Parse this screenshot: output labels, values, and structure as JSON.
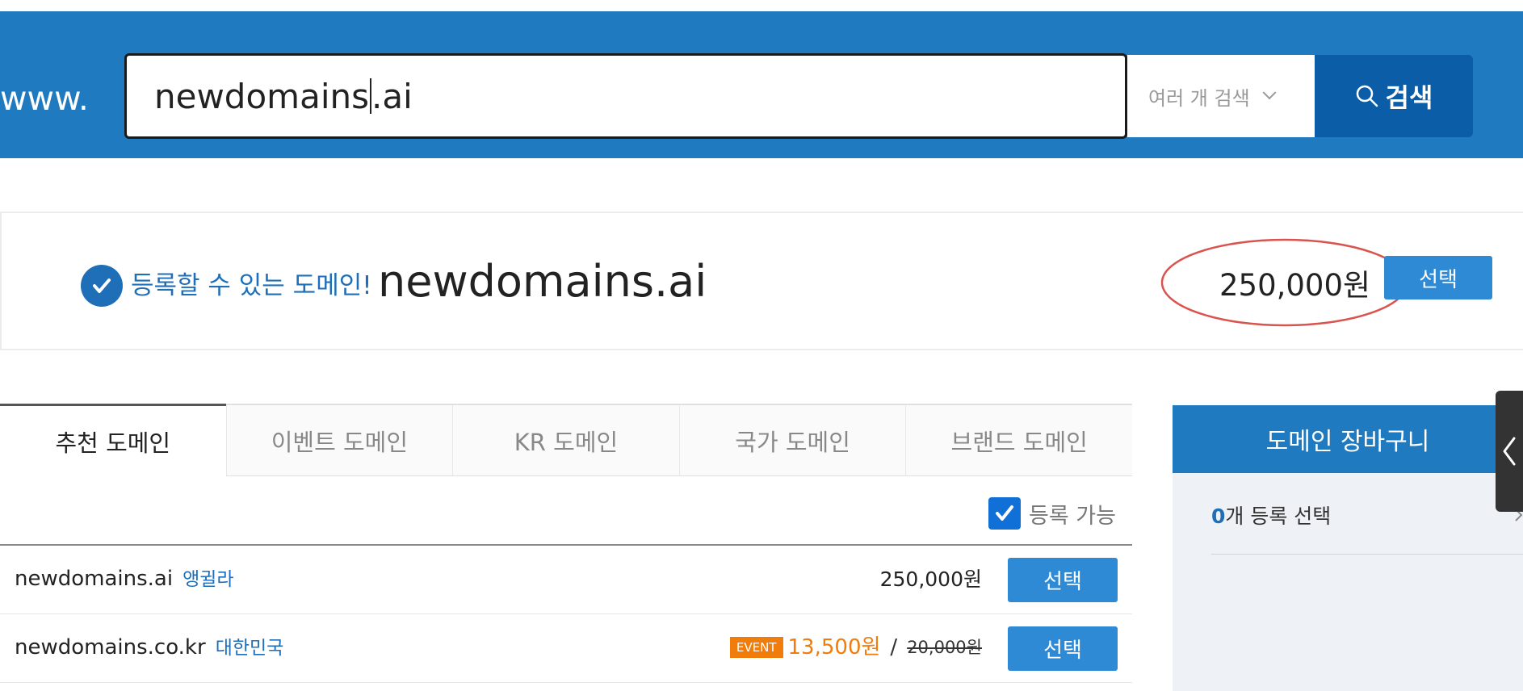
{
  "search": {
    "prefix": "www.",
    "query_before_caret": "newdomains",
    "query_after_caret": ".ai",
    "multi_search_label": "여러 개 검색",
    "button_label": "검색"
  },
  "result": {
    "status_text": "등록할 수 있는 도메인!",
    "domain": "newdomains.ai",
    "price": "250,000원",
    "select_label": "선택"
  },
  "tabs": [
    {
      "label": "추천 도메인",
      "active": true
    },
    {
      "label": "이벤트 도메인",
      "active": false
    },
    {
      "label": "KR 도메인",
      "active": false
    },
    {
      "label": "국가 도메인",
      "active": false
    },
    {
      "label": "브랜드 도메인",
      "active": false
    }
  ],
  "filter": {
    "label": "등록 가능",
    "checked": true
  },
  "domains": [
    {
      "name": "newdomains.ai",
      "country": "앵귈라",
      "price": "250,000원",
      "select_label": "선택"
    },
    {
      "name": "newdomains.co.kr",
      "country": "대한민국",
      "event_badge": "EVENT",
      "event_price": "13,500원",
      "slash": "/",
      "original_price": "20,000원",
      "select_label": "선택"
    }
  ],
  "cart": {
    "title": "도메인 장바구니",
    "count": "0",
    "count_suffix": "개 등록 선택"
  },
  "colors": {
    "header_blue": "#1f7abf",
    "button_dark_blue": "#0a5da6",
    "button_blue": "#2f8ad6",
    "text_blue": "#1f6fb8",
    "event_orange": "#f07c0c",
    "highlight_red": "#d9534f"
  },
  "icons": {
    "search_button": "search-icon",
    "multi_search": "chevron-down-icon",
    "result_status": "check-circle-icon",
    "filter": "checkbox-checked-icon",
    "side_toggle": "chevron-left-icon",
    "cart_row": "chevron-right-icon"
  }
}
